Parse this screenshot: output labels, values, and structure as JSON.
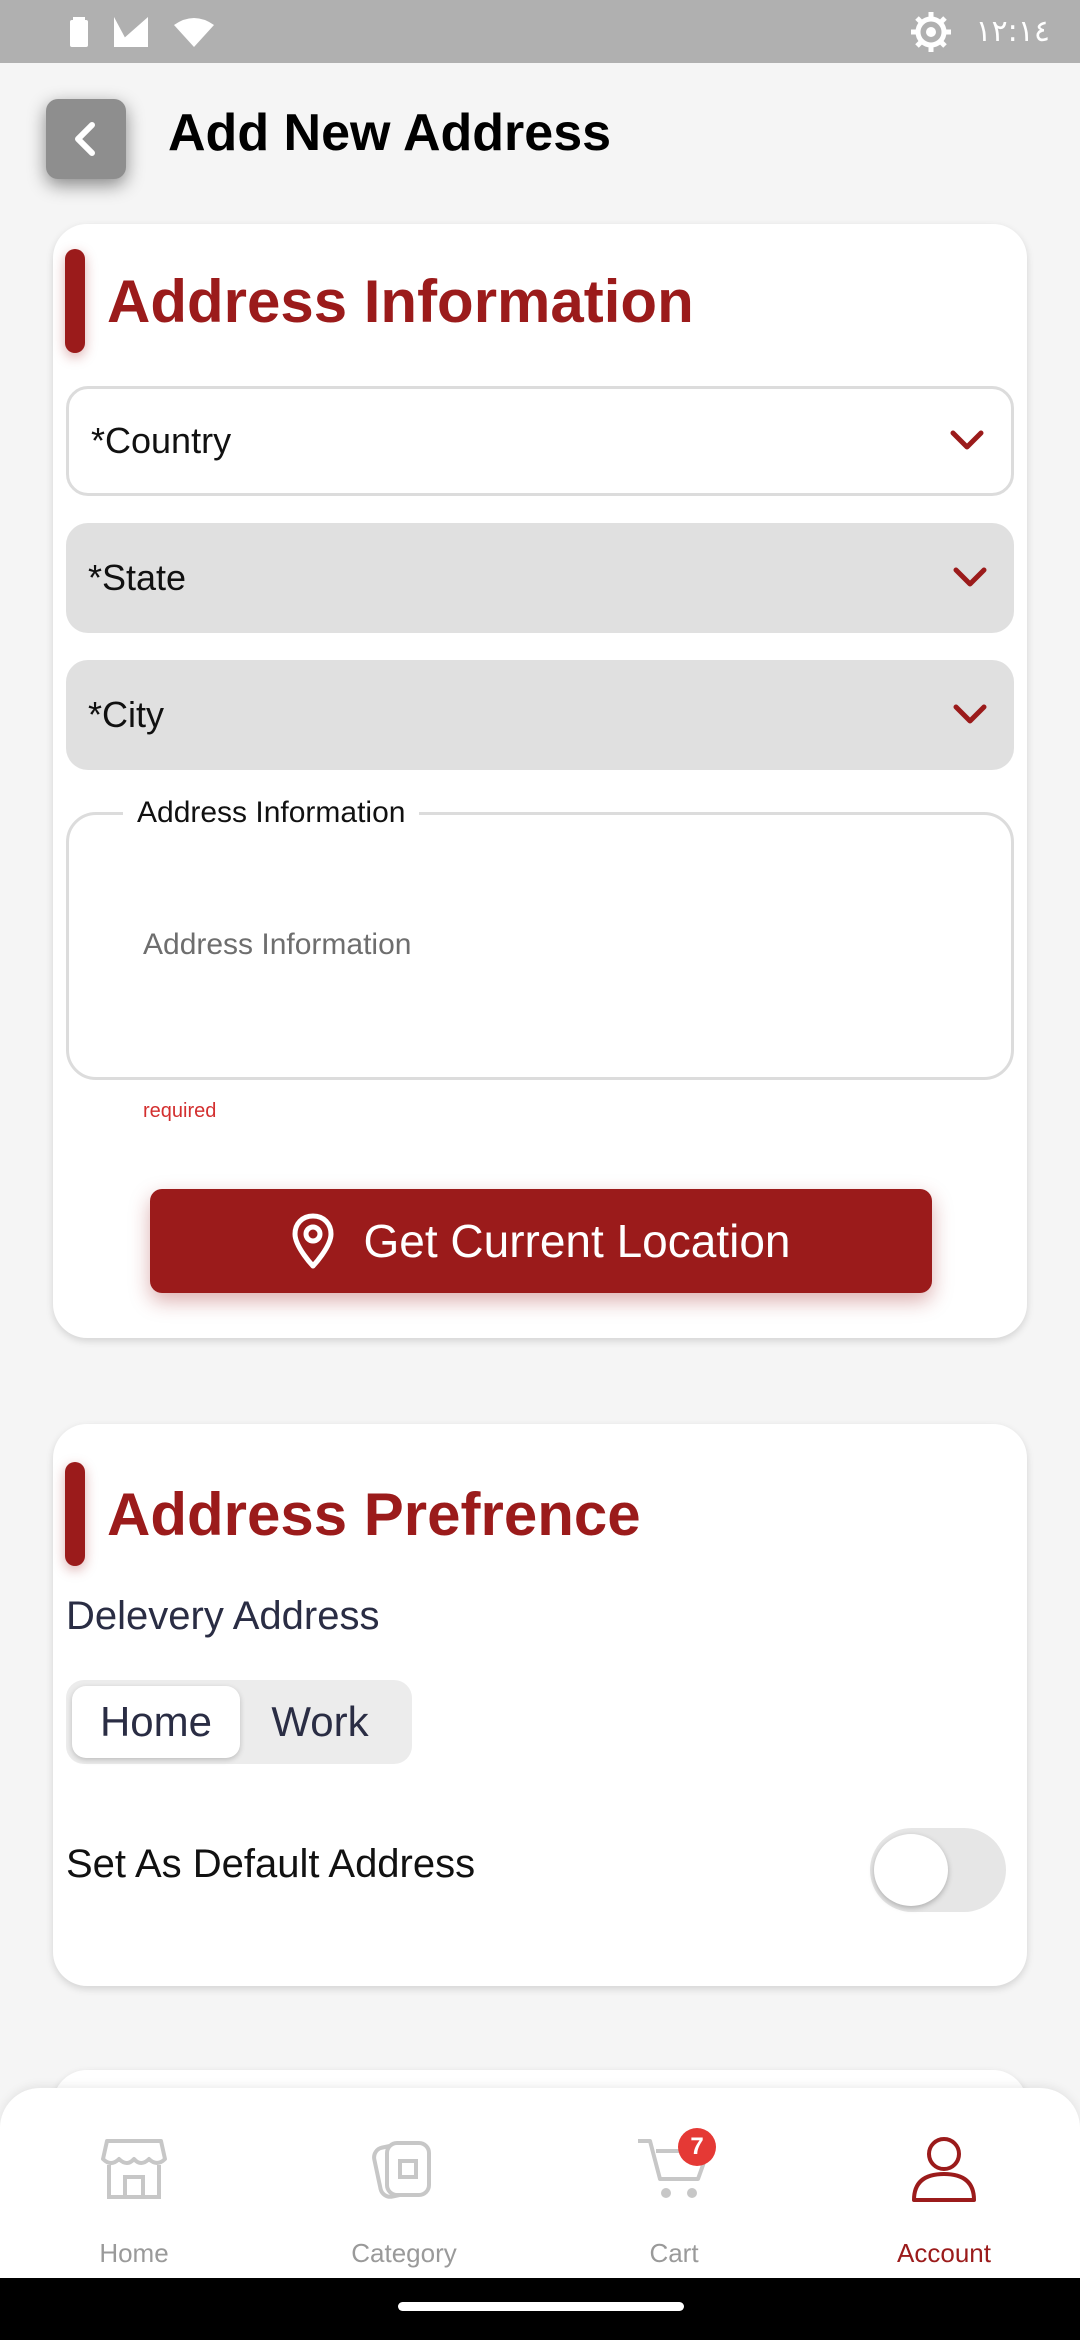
{
  "status_bar": {
    "time": "١٢:١٤",
    "icons": [
      "battery-icon",
      "signal-icon",
      "wifi-icon",
      "settings-gear-icon"
    ]
  },
  "header": {
    "title": "Add New Address",
    "back_icon": "chevron-left-icon"
  },
  "address_information": {
    "title": "Address Information",
    "country": {
      "label": "*Country",
      "icon": "chevron-down-icon"
    },
    "state": {
      "label": "*State",
      "icon": "chevron-down-icon"
    },
    "city": {
      "label": "*City",
      "icon": "chevron-down-icon"
    },
    "address_field": {
      "legend": "Address Information",
      "placeholder": "Address Information",
      "error": "required"
    },
    "location_button": {
      "label": "Get Current Location",
      "icon": "map-pin-icon"
    }
  },
  "address_preference": {
    "title": "Address Prefrence",
    "delivery_label": "Delevery Address",
    "options": [
      "Home",
      "Work"
    ],
    "selected_option": "Home",
    "default_label": "Set As Default Address",
    "default_on": false
  },
  "bottom_nav": {
    "items": [
      {
        "label": "Home",
        "icon": "store-icon",
        "active": false
      },
      {
        "label": "Category",
        "icon": "category-icon",
        "active": false
      },
      {
        "label": "Cart",
        "icon": "cart-icon",
        "active": false,
        "badge": "7"
      },
      {
        "label": "Account",
        "icon": "user-icon",
        "active": true
      }
    ]
  },
  "colors": {
    "accent": "#9b1b1b",
    "error": "#d32f2f",
    "badge": "#e53935",
    "inactive_nav": "#9a9a9a"
  }
}
